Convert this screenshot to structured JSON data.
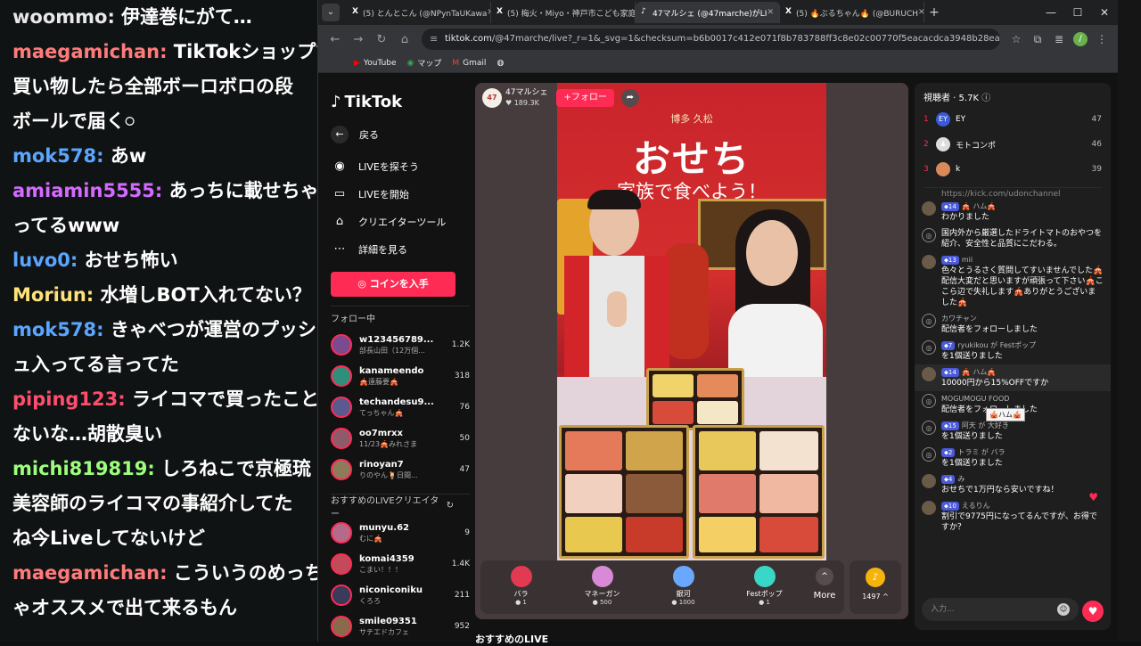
{
  "overlay_chat": [
    {
      "user": "woommo:",
      "text": " 伊達巻にがて…",
      "color": "#e8e8e8"
    },
    {
      "user": "maegamichan:",
      "text": " TikTokショップで",
      "color": "#ff7b7b"
    },
    {
      "user": "",
      "text": "買い物したら全部ボーロボロの段",
      "color": "#ff7b7b"
    },
    {
      "user": "",
      "text": "ボールで届く𓏸",
      "color": "#ff7b7b"
    },
    {
      "user": "mok578:",
      "text": " あw",
      "color": "#5aa5ff"
    },
    {
      "user": "amiamin5555:",
      "text": " あっちに載せちゃ",
      "color": "#d36bff"
    },
    {
      "user": "",
      "text": "ってるwww",
      "color": "#d36bff"
    },
    {
      "user": "luvo0:",
      "text": " おせち怖い",
      "color": "#5aa5ff"
    },
    {
      "user": "Moriun:",
      "text": " 水増しBOT入れてない？",
      "color": "#ffe27b"
    },
    {
      "user": "mok578:",
      "text": " きゃべつが運営のプッシ",
      "color": "#5aa5ff"
    },
    {
      "user": "",
      "text": "ュ入ってる言ってた",
      "color": "#5aa5ff"
    },
    {
      "user": "piping123:",
      "text": " ライコマで買ったこと",
      "color": "#ff4d6d"
    },
    {
      "user": "",
      "text": "ないな…胡散臭い",
      "color": "#ff4d6d"
    },
    {
      "user": "michi819819:",
      "text": " しろねこで京極琉",
      "color": "#9cff7b"
    },
    {
      "user": "",
      "text": "美容師のライコマの事紹介してた",
      "color": "#9cff7b"
    },
    {
      "user": "",
      "text": "ね今Liveしてないけど",
      "color": "#9cff7b"
    },
    {
      "user": "maegamichan:",
      "text": " こういうのめっち",
      "color": "#ff7b7b"
    },
    {
      "user": "",
      "text": "ゃオススメで出て来るもん",
      "color": "#ff7b7b"
    }
  ],
  "browser": {
    "tabs": [
      {
        "label": "(5) とんとこん (@NPynTaUKawa",
        "icon": "X",
        "active": false
      },
      {
        "label": "(5) 梅火・Miyo・神戸市こども家庭",
        "icon": "X",
        "active": false
      },
      {
        "label": "47マルシェ (@47marche)がLI",
        "icon": "♪",
        "active": true
      },
      {
        "label": "(5) 🔥ぶるちゃん🔥 (@BURUCH",
        "icon": "X",
        "active": false
      }
    ],
    "new_tab": "+",
    "url_host": "tiktok.com",
    "url_rest": "/@47marche/live?_r=1&_svg=1&checksum=b6b0017c412e071f8b783788ff3c8e02c00770f5eacacdca3948b28ea5d7bd90&enter_f...",
    "bookmarks": [
      {
        "icon": "▶",
        "label": "YouTube",
        "color": "#ff0000"
      },
      {
        "icon": "◉",
        "label": "マップ",
        "color": "#34a853"
      },
      {
        "icon": "M",
        "label": "Gmail",
        "color": "#ea4335"
      },
      {
        "icon": "◍",
        "label": "",
        "color": "#ffffff"
      }
    ]
  },
  "sidebar": {
    "logo": "TikTok",
    "back": "戻る",
    "nav": [
      {
        "icon": "◉",
        "label": "LIVEを探そう"
      },
      {
        "icon": "▭",
        "label": "LIVEを開始"
      },
      {
        "icon": "⌂",
        "label": "クリエイターツール"
      },
      {
        "icon": "⋯",
        "label": "詳細を見る"
      }
    ],
    "coin_button": "コインを入手",
    "following_header": "フォロー中",
    "following": [
      {
        "name": "w123456789...",
        "sub": "部長山田（12万個...",
        "count": "1.2K",
        "color": "#7a4b8f"
      },
      {
        "name": "kanameendo",
        "sub": "🎪遠藤要🎪",
        "count": "318",
        "color": "#2f8f7a"
      },
      {
        "name": "techandesu9...",
        "sub": "てっちゃん🎪",
        "count": "76",
        "color": "#5a5a8f"
      },
      {
        "name": "oo7mrxx",
        "sub": "11/23🎪みれさま",
        "count": "50",
        "color": "#8f5a6a"
      },
      {
        "name": "rinoyan7",
        "sub": "りのやん🍹日間...",
        "count": "47",
        "color": "#8f7a5a"
      }
    ],
    "recommended_header": "おすすめのLIVEクリエイター",
    "recommended": [
      {
        "name": "munyu.62",
        "sub": "むに🎪",
        "count": "9",
        "color": "#b46a8a"
      },
      {
        "name": "komai4359",
        "sub": "こまい！！！",
        "count": "1.4K",
        "color": "#c24a5a"
      },
      {
        "name": "niconiconiku",
        "sub": "くろろ",
        "count": "211",
        "color": "#3a3a5a"
      },
      {
        "name": "smile09351",
        "sub": "サチエドカフェ",
        "count": "952",
        "color": "#8a6a4a"
      }
    ]
  },
  "player": {
    "host": "47マルシェ",
    "host_avatar": "47",
    "likes": "♥ 189.3K",
    "follow": "+フォロー",
    "share_icon": "share-icon",
    "video_brand": "博多 久松",
    "video_title": "おせち",
    "video_subtitle": "家族で食べよう！",
    "gifts": [
      {
        "name": "バラ",
        "price": "1",
        "color": "#e23a52"
      },
      {
        "name": "マネーガン",
        "price": "500",
        "color": "#d88ad6"
      },
      {
        "name": "銀河",
        "price": "1000",
        "color": "#6aa8ff"
      },
      {
        "name": "Festポップ",
        "price": "1",
        "color": "#3ad6c8"
      }
    ],
    "more": "More",
    "coins": "1497 ^",
    "coin_icon": "♪"
  },
  "recommended_live": "おすすめのLIVE",
  "chat": {
    "viewers_label": "視聴者 · 5.7K",
    "ranking": [
      {
        "n": "1",
        "name": "EY",
        "value": "47",
        "av": "EY",
        "color": "#3a5ad8"
      },
      {
        "n": "2",
        "name": "モトコンポ",
        "value": "46",
        "av": "♟",
        "color": "#dddddd"
      },
      {
        "n": "3",
        "name": "k",
        "value": "39",
        "av": "",
        "color": "#d88a5a"
      }
    ],
    "link": "https://kick.com/udonchannel",
    "messages": [
      {
        "badge": "14",
        "user": "🎪 ハム🎪",
        "body": "わかりました",
        "sys": false
      },
      {
        "badge": "",
        "user": "",
        "body": "国内外から厳選したドライトマトのおやつを紹介、安全性と品質にこだわる。",
        "sys": true
      },
      {
        "badge": "13",
        "user": "mii",
        "body": "色々とうるさく質問してすいませんでした🎪配信大変だと思いますが頑張って下さい🎪ここら辺で失礼します🎪ありがとうございました🎪",
        "sys": false
      },
      {
        "badge": "",
        "user": "カワチャン",
        "body": "配信者をフォローしました",
        "sys": true
      },
      {
        "badge": "7",
        "user": "ryukikou が Festポップ",
        "body": "を1個送りました",
        "sys": true
      },
      {
        "badge": "14",
        "user": "🎪 ハム🎪",
        "body": "10000円から15%OFFですか",
        "sys": false
      },
      {
        "badge": "",
        "user": "MOGUMOGU FOOD",
        "body": "配信者をフォローしました",
        "sys": true
      },
      {
        "badge": "15",
        "user": "阿天 が 大好き",
        "body": "を1個送りました",
        "sys": true
      },
      {
        "badge": "2",
        "user": "トラミ が バラ",
        "body": "を1個送りました",
        "sys": true
      },
      {
        "badge": "4",
        "user": "み",
        "body": "おせちで1万円なら安いですね！",
        "sys": false
      },
      {
        "badge": "10",
        "user": "えるりん",
        "body": "割引で9775円になってるんですが、お得ですか？",
        "sys": false
      }
    ],
    "tooltip": "🎪ハム🎪",
    "input_placeholder": "入力...",
    "emoji_icon": "☺",
    "heart_icon": "♥"
  }
}
